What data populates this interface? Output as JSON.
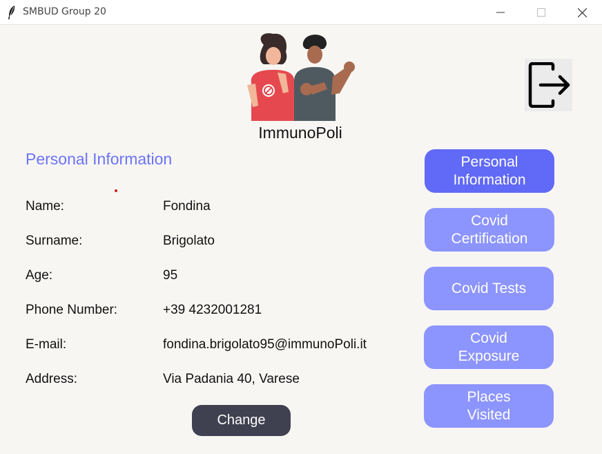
{
  "window": {
    "title": "SMBUD Group 20"
  },
  "header": {
    "brand": "ImmunoPoli",
    "logout_icon": "logout-icon"
  },
  "section": {
    "title": "Personal Information"
  },
  "fields": [
    {
      "label": "Name:",
      "value": "Fondina"
    },
    {
      "label": "Surname:",
      "value": "Brigolato"
    },
    {
      "label": "Age:",
      "value": "95"
    },
    {
      "label": "Phone Number:",
      "value": "+39 4232001281"
    },
    {
      "label": "E-mail:",
      "value": "fondina.brigolato95@immunoPoli.it"
    },
    {
      "label": "Address:",
      "value": "Via Padania 40, Varese"
    }
  ],
  "actions": {
    "change_label": "Change"
  },
  "nav": [
    {
      "label": "Personal\nInformation",
      "active": true
    },
    {
      "label": "Covid\nCertification",
      "active": false
    },
    {
      "label": "Covid Tests",
      "active": false
    },
    {
      "label": "Covid\nExposure",
      "active": false
    },
    {
      "label": "Places\nVisited",
      "active": false
    }
  ],
  "colors": {
    "accent": "#6b74f6",
    "nav_active": "#6169f7",
    "nav_inactive": "#8c94fe",
    "change_button": "#3f4050",
    "background": "#f8f6f3"
  }
}
